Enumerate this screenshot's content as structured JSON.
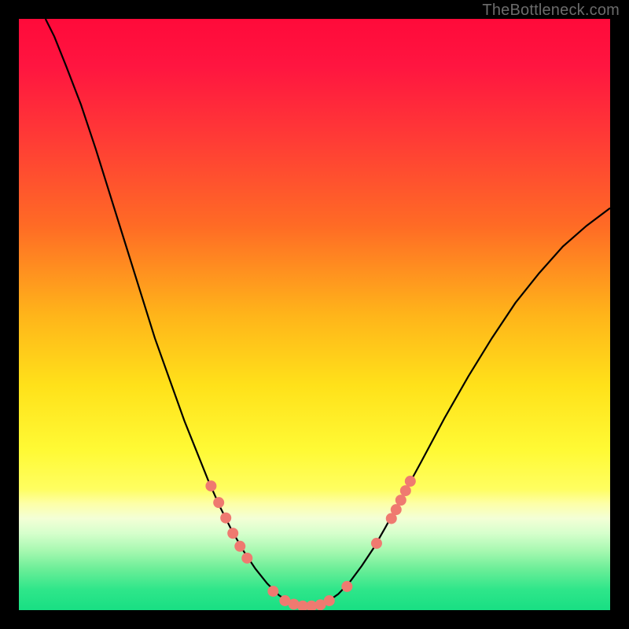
{
  "watermark": "TheBottleneck.com",
  "colors": {
    "gradient_stops": [
      {
        "offset": 0.0,
        "color": "#ff0a3a"
      },
      {
        "offset": 0.08,
        "color": "#ff1540"
      },
      {
        "offset": 0.2,
        "color": "#ff3a36"
      },
      {
        "offset": 0.35,
        "color": "#ff6b25"
      },
      {
        "offset": 0.5,
        "color": "#ffb41a"
      },
      {
        "offset": 0.62,
        "color": "#ffe11a"
      },
      {
        "offset": 0.73,
        "color": "#fffa35"
      },
      {
        "offset": 0.795,
        "color": "#fffe60"
      },
      {
        "offset": 0.82,
        "color": "#fdffa8"
      },
      {
        "offset": 0.845,
        "color": "#f3ffd6"
      },
      {
        "offset": 0.87,
        "color": "#d6ffcc"
      },
      {
        "offset": 0.9,
        "color": "#a6f8b0"
      },
      {
        "offset": 0.93,
        "color": "#6cee98"
      },
      {
        "offset": 0.965,
        "color": "#2fe68a"
      },
      {
        "offset": 1.0,
        "color": "#18df83"
      }
    ],
    "curve": "#000000",
    "curve_width": 2.2,
    "dot_fill": "#ef7a70",
    "dot_radius": 7
  },
  "chart_data": {
    "type": "line",
    "title": "",
    "xlabel": "",
    "ylabel": "",
    "xlim": [
      0,
      100
    ],
    "ylim": [
      0,
      100
    ],
    "curve": [
      {
        "x": 4.5,
        "y": 100.0
      },
      {
        "x": 6.0,
        "y": 97.0
      },
      {
        "x": 8.0,
        "y": 92.0
      },
      {
        "x": 10.5,
        "y": 85.5
      },
      {
        "x": 13.0,
        "y": 78.0
      },
      {
        "x": 15.5,
        "y": 70.0
      },
      {
        "x": 18.0,
        "y": 62.0
      },
      {
        "x": 20.5,
        "y": 54.0
      },
      {
        "x": 23.0,
        "y": 46.0
      },
      {
        "x": 25.5,
        "y": 39.0
      },
      {
        "x": 28.0,
        "y": 32.0
      },
      {
        "x": 30.0,
        "y": 27.0
      },
      {
        "x": 32.0,
        "y": 22.0
      },
      {
        "x": 34.0,
        "y": 17.5
      },
      {
        "x": 36.0,
        "y": 13.5
      },
      {
        "x": 38.0,
        "y": 10.0
      },
      {
        "x": 40.0,
        "y": 7.0
      },
      {
        "x": 42.0,
        "y": 4.5
      },
      {
        "x": 44.0,
        "y": 2.5
      },
      {
        "x": 46.0,
        "y": 1.2
      },
      {
        "x": 48.0,
        "y": 0.7
      },
      {
        "x": 50.0,
        "y": 0.7
      },
      {
        "x": 52.0,
        "y": 1.3
      },
      {
        "x": 54.0,
        "y": 2.7
      },
      {
        "x": 56.0,
        "y": 4.8
      },
      {
        "x": 58.0,
        "y": 7.5
      },
      {
        "x": 60.0,
        "y": 10.5
      },
      {
        "x": 62.0,
        "y": 14.0
      },
      {
        "x": 65.0,
        "y": 19.5
      },
      {
        "x": 68.0,
        "y": 25.0
      },
      {
        "x": 72.0,
        "y": 32.5
      },
      {
        "x": 76.0,
        "y": 39.5
      },
      {
        "x": 80.0,
        "y": 46.0
      },
      {
        "x": 84.0,
        "y": 52.0
      },
      {
        "x": 88.0,
        "y": 57.0
      },
      {
        "x": 92.0,
        "y": 61.5
      },
      {
        "x": 96.0,
        "y": 65.0
      },
      {
        "x": 100.0,
        "y": 68.0
      }
    ],
    "dots": [
      {
        "x": 32.5,
        "y": 21.0
      },
      {
        "x": 33.8,
        "y": 18.2
      },
      {
        "x": 35.0,
        "y": 15.6
      },
      {
        "x": 36.2,
        "y": 13.0
      },
      {
        "x": 37.4,
        "y": 10.8
      },
      {
        "x": 38.6,
        "y": 8.8
      },
      {
        "x": 43.0,
        "y": 3.2
      },
      {
        "x": 45.0,
        "y": 1.6
      },
      {
        "x": 46.5,
        "y": 1.0
      },
      {
        "x": 48.0,
        "y": 0.7
      },
      {
        "x": 49.5,
        "y": 0.7
      },
      {
        "x": 51.0,
        "y": 0.9
      },
      {
        "x": 52.5,
        "y": 1.6
      },
      {
        "x": 55.5,
        "y": 4.0
      },
      {
        "x": 60.5,
        "y": 11.3
      },
      {
        "x": 63.0,
        "y": 15.5
      },
      {
        "x": 63.8,
        "y": 17.0
      },
      {
        "x": 64.6,
        "y": 18.6
      },
      {
        "x": 65.4,
        "y": 20.2
      },
      {
        "x": 66.2,
        "y": 21.8
      }
    ]
  }
}
